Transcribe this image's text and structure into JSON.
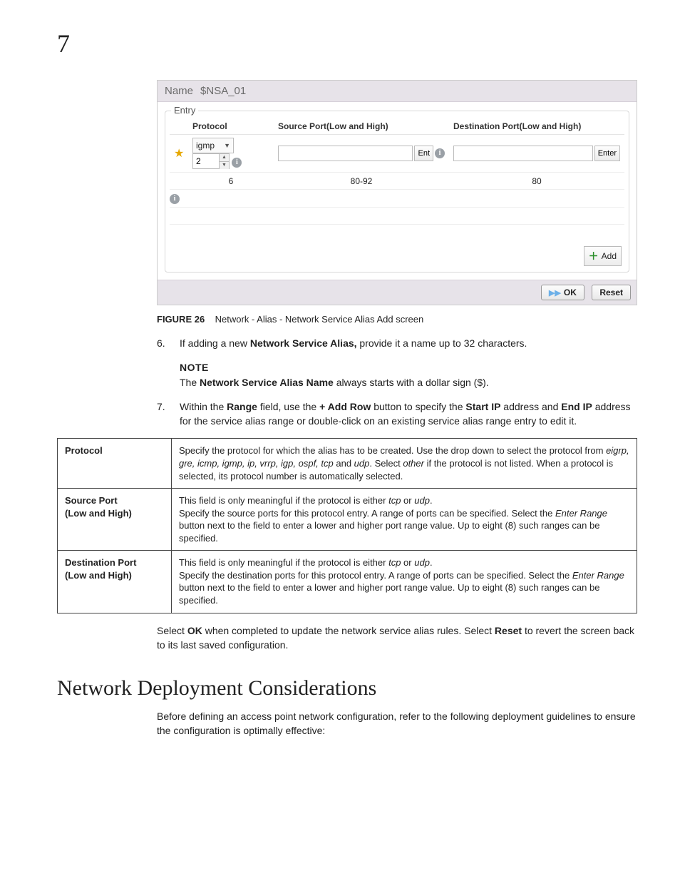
{
  "chapter": "7",
  "figure": {
    "name_label": "Name",
    "name_value": "$NSA_01",
    "entry_legend": "Entry",
    "headers": {
      "protocol": "Protocol",
      "source": "Source Port(Low and High)",
      "dest": "Destination Port(Low and High)"
    },
    "editing_row": {
      "protocol_value": "igmp",
      "protocol_number": "2",
      "source_value": "",
      "source_btn": "Ent",
      "dest_value": "",
      "dest_btn": "Enter"
    },
    "row2": {
      "protocol": "6",
      "source": "80-92",
      "dest": "80"
    },
    "add_btn": "Add",
    "ok_btn": "OK",
    "reset_btn": "Reset"
  },
  "caption": {
    "label": "FIGURE 26",
    "text": "Network - Alias - Network Service Alias Add screen"
  },
  "step6": {
    "num": "6.",
    "pre": "If adding a new ",
    "bold": "Network Service Alias,",
    "post": " provide it a name up to 32 characters."
  },
  "note": {
    "head": "NOTE",
    "pre": "The ",
    "bold": "Network Service Alias Name",
    "post": " always starts with a dollar sign ($)."
  },
  "step7": {
    "num": "7.",
    "t1": "Within the ",
    "b1": "Range",
    "t2": " field, use the ",
    "b2": "+ Add Row",
    "t3": " button to specify the ",
    "b3": "Start IP",
    "t4": " address and ",
    "b4": "End IP",
    "t5": " address for the service alias range or double-click on an existing service alias range entry to edit it."
  },
  "descTable": {
    "protocol": {
      "label": "Protocol",
      "d1": "Specify the protocol for which the alias has to be created. Use the drop down to select the protocol from ",
      "protos": "eigrp, gre, icmp, igmp, ip, vrrp, igp, ospf, tcp",
      "d2": " and ",
      "udp": "udp",
      "d3": ". Select ",
      "other": "other",
      "d4": " if the protocol is not listed. When a protocol is selected, its protocol number is automatically selected."
    },
    "source": {
      "label1": "Source Port",
      "label2": "(Low and High)",
      "d1": "This field is only meaningful if the protocol is either ",
      "tcp": "tcp",
      "or": " or ",
      "udp": "udp",
      "dot": ".",
      "d2": "Specify the source ports for this protocol entry. A range of ports can be specified. Select the ",
      "er": "Enter Range",
      "d3": " button next to the field to enter a lower and higher port range value. Up to eight (8) such ranges can be specified."
    },
    "dest": {
      "label1": "Destination Port",
      "label2": "(Low and High)",
      "d1": "This field is only meaningful if the protocol is either ",
      "tcp": "tcp",
      "or": " or ",
      "udp": "udp",
      "dot": ".",
      "d2": "Specify the destination ports for this protocol entry. A range of ports can be specified. Select the ",
      "er": "Enter Range",
      "d3": " button next to the field to enter a lower and higher port range value. Up to eight (8) such ranges can be specified."
    }
  },
  "closing": {
    "t1": "Select ",
    "b1": "OK",
    "t2": " when completed to update the network service alias rules. Select ",
    "b2": "Reset",
    "t3": " to revert the screen back to its last saved configuration."
  },
  "section_title": "Network Deployment Considerations",
  "section_intro": "Before defining an access point network configuration, refer to the following deployment guidelines to ensure the configuration is optimally effective:"
}
